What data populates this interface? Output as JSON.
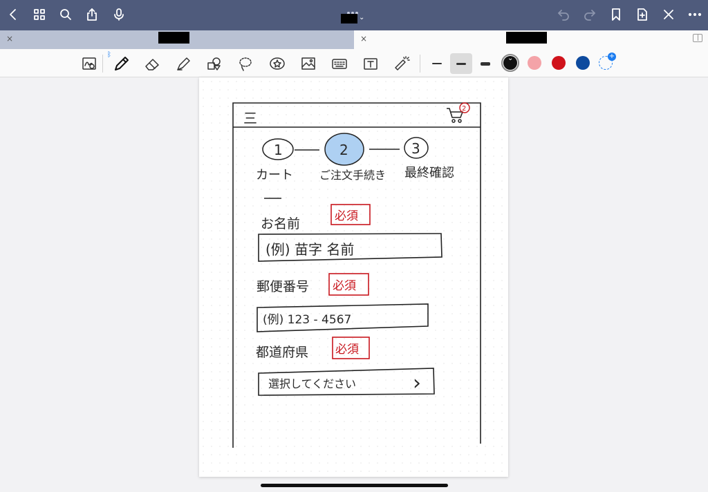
{
  "topbar": {
    "icons": [
      "chevron-left-icon",
      "grid-icon",
      "search-icon",
      "share-icon",
      "microphone-icon",
      "undo-icon",
      "redo-icon",
      "bookmark-icon",
      "add-page-icon",
      "close-icon",
      "more-icon"
    ],
    "title_chevron": "⌄"
  },
  "tabs": {
    "close_symbol": "×"
  },
  "toolbar": {
    "bluetooth": "ᛒ",
    "colors": {
      "black": "#111111",
      "pink": "#f4a3a8",
      "red": "#d0121b",
      "blue": "#0d4a9e",
      "accent": "#1a7cf0"
    },
    "add_symbol": "+"
  },
  "sketch": {
    "menu_glyph": "三",
    "cart_badge": "2",
    "steps": [
      {
        "number": "1",
        "label": "カート"
      },
      {
        "number": "2",
        "label": "ご注文手続き"
      },
      {
        "number": "3",
        "label": "最終確認"
      }
    ],
    "fields": [
      {
        "label": "お名前",
        "required": "必須",
        "placeholder": "(例) 苗字 名前"
      },
      {
        "label": "郵便番号",
        "required": "必須",
        "placeholder": "(例) 123 - 4567"
      },
      {
        "label": "都道府県",
        "required": "必須",
        "placeholder": "選択してください",
        "chevron": "›"
      }
    ]
  }
}
